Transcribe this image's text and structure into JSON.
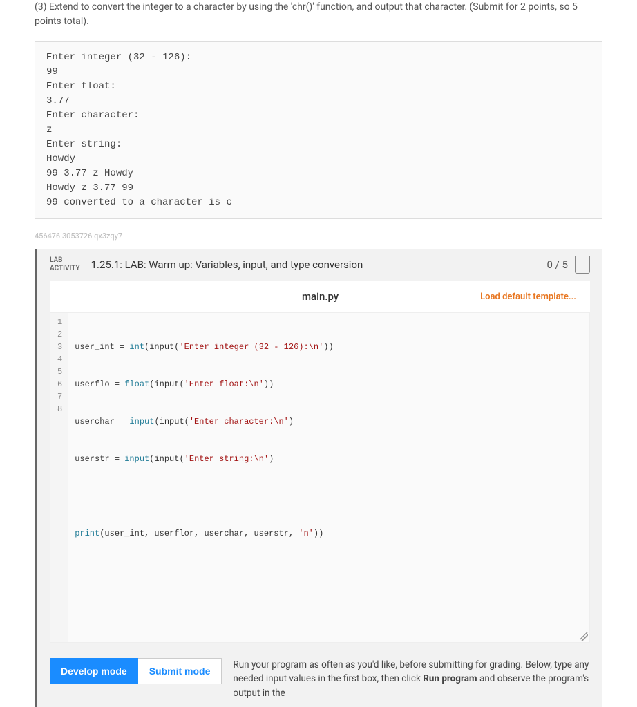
{
  "instruction": "(3) Extend to convert the integer to a character by using the 'chr()' function, and output that character. (Submit for 2 points, so 5 points total).",
  "sample_output": "Enter integer (32 - 126):\n99\nEnter float:\n3.77\nEnter character:\nz\nEnter string:\nHowdy\n99 3.77 z Howdy\nHowdy z 3.77 99\n99 converted to a character is c",
  "watermark": "456476.3053726.qx3zqy7",
  "lab": {
    "activity_label": "LAB\nACTIVITY",
    "title": "1.25.1: LAB: Warm up: Variables, input, and type conversion",
    "score": "0 / 5"
  },
  "editor": {
    "filename": "main.py",
    "load_template": "Load default template...",
    "line_numbers": [
      "1",
      "2",
      "3",
      "4",
      "5",
      "6",
      "7",
      "8"
    ],
    "code": {
      "l1_var": "user_int",
      "l1_eq": " = ",
      "l1_fn": "int",
      "l1_p": "(input(",
      "l1_str": "'Enter integer (32 - 126):\\n'",
      "l1_close": "))",
      "l2_var": "userflo",
      "l2_eq": " = ",
      "l2_fn": "float",
      "l2_p": "(input(",
      "l2_str": "'Enter float:\\n'",
      "l2_close": "))",
      "l3_var": "userchar",
      "l3_eq": " = ",
      "l3_fn": "input",
      "l3_p": "(input(",
      "l3_str": "'Enter character:\\n'",
      "l3_close": ")",
      "l4_var": "userstr",
      "l4_eq": " = ",
      "l4_fn": "input",
      "l4_p": "(input(",
      "l4_str": "'Enter string:\\n'",
      "l4_close": ")",
      "l6_fn": "print",
      "l6_args": "(user_int, userflor, userchar, userstr, ",
      "l6_str": "'n'",
      "l6_close": "))"
    }
  },
  "modes": {
    "develop": "Develop mode",
    "submit": "Submit mode",
    "desc_pre": "Run your program as often as you'd like, before submitting for grading. Below, type any needed input values in the first box, then click ",
    "desc_strong": "Run program",
    "desc_post": " and observe the program's output in the"
  }
}
